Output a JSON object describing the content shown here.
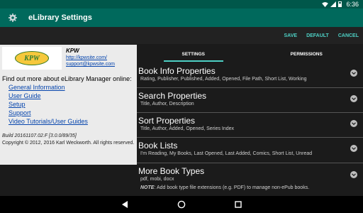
{
  "status": {
    "time": "6:36"
  },
  "header": {
    "title": "eLibrary Settings"
  },
  "actions": {
    "save": "SAVE",
    "default": "DEFAULT",
    "cancel": "CANCEL"
  },
  "left": {
    "logo_text": "KPW",
    "contact_name": "KPW",
    "website": "http://kpwsite.com/",
    "email": "support@kpwsite.com",
    "find_out": "Find out more about eLibrary Manager online:",
    "links": [
      "General Information",
      "User Guide",
      "Setup",
      "Support",
      "Video Tutorials/User Guides"
    ],
    "build": "Build 20161107.02.F [3.0.0/89/35]",
    "copyright": "Copyright © 2012, 2016 Karl Weckworth. All rights reserved."
  },
  "tabs": [
    "SETTINGS",
    "PERMISSIONS"
  ],
  "prefs": [
    {
      "title": "Book Info Properties",
      "summary": "Rating, Publisher, Published, Added, Opened, File Path, Short List, Working"
    },
    {
      "title": "Search Properties",
      "summary": "Title, Author, Description"
    },
    {
      "title": "Sort Properties",
      "summary": "Title, Author, Added, Opened, Series Index"
    },
    {
      "title": "Book Lists",
      "summary": "I'm Reading, My Books, Last Opened, Last Added, Comics, Short List, Unread"
    },
    {
      "title": "More Book Types",
      "summary": "pdf, mobi, docx",
      "note_label": "NOTE",
      "note_text": ": Add book type file extensions (e.g. PDF) to manage non-ePub books."
    }
  ],
  "colors": {
    "status_bar": "#00574a",
    "title_bar": "#00695c",
    "accent": "#4dd0c4",
    "left_pane": "#ebebeb",
    "background": "#1b1b1b"
  }
}
